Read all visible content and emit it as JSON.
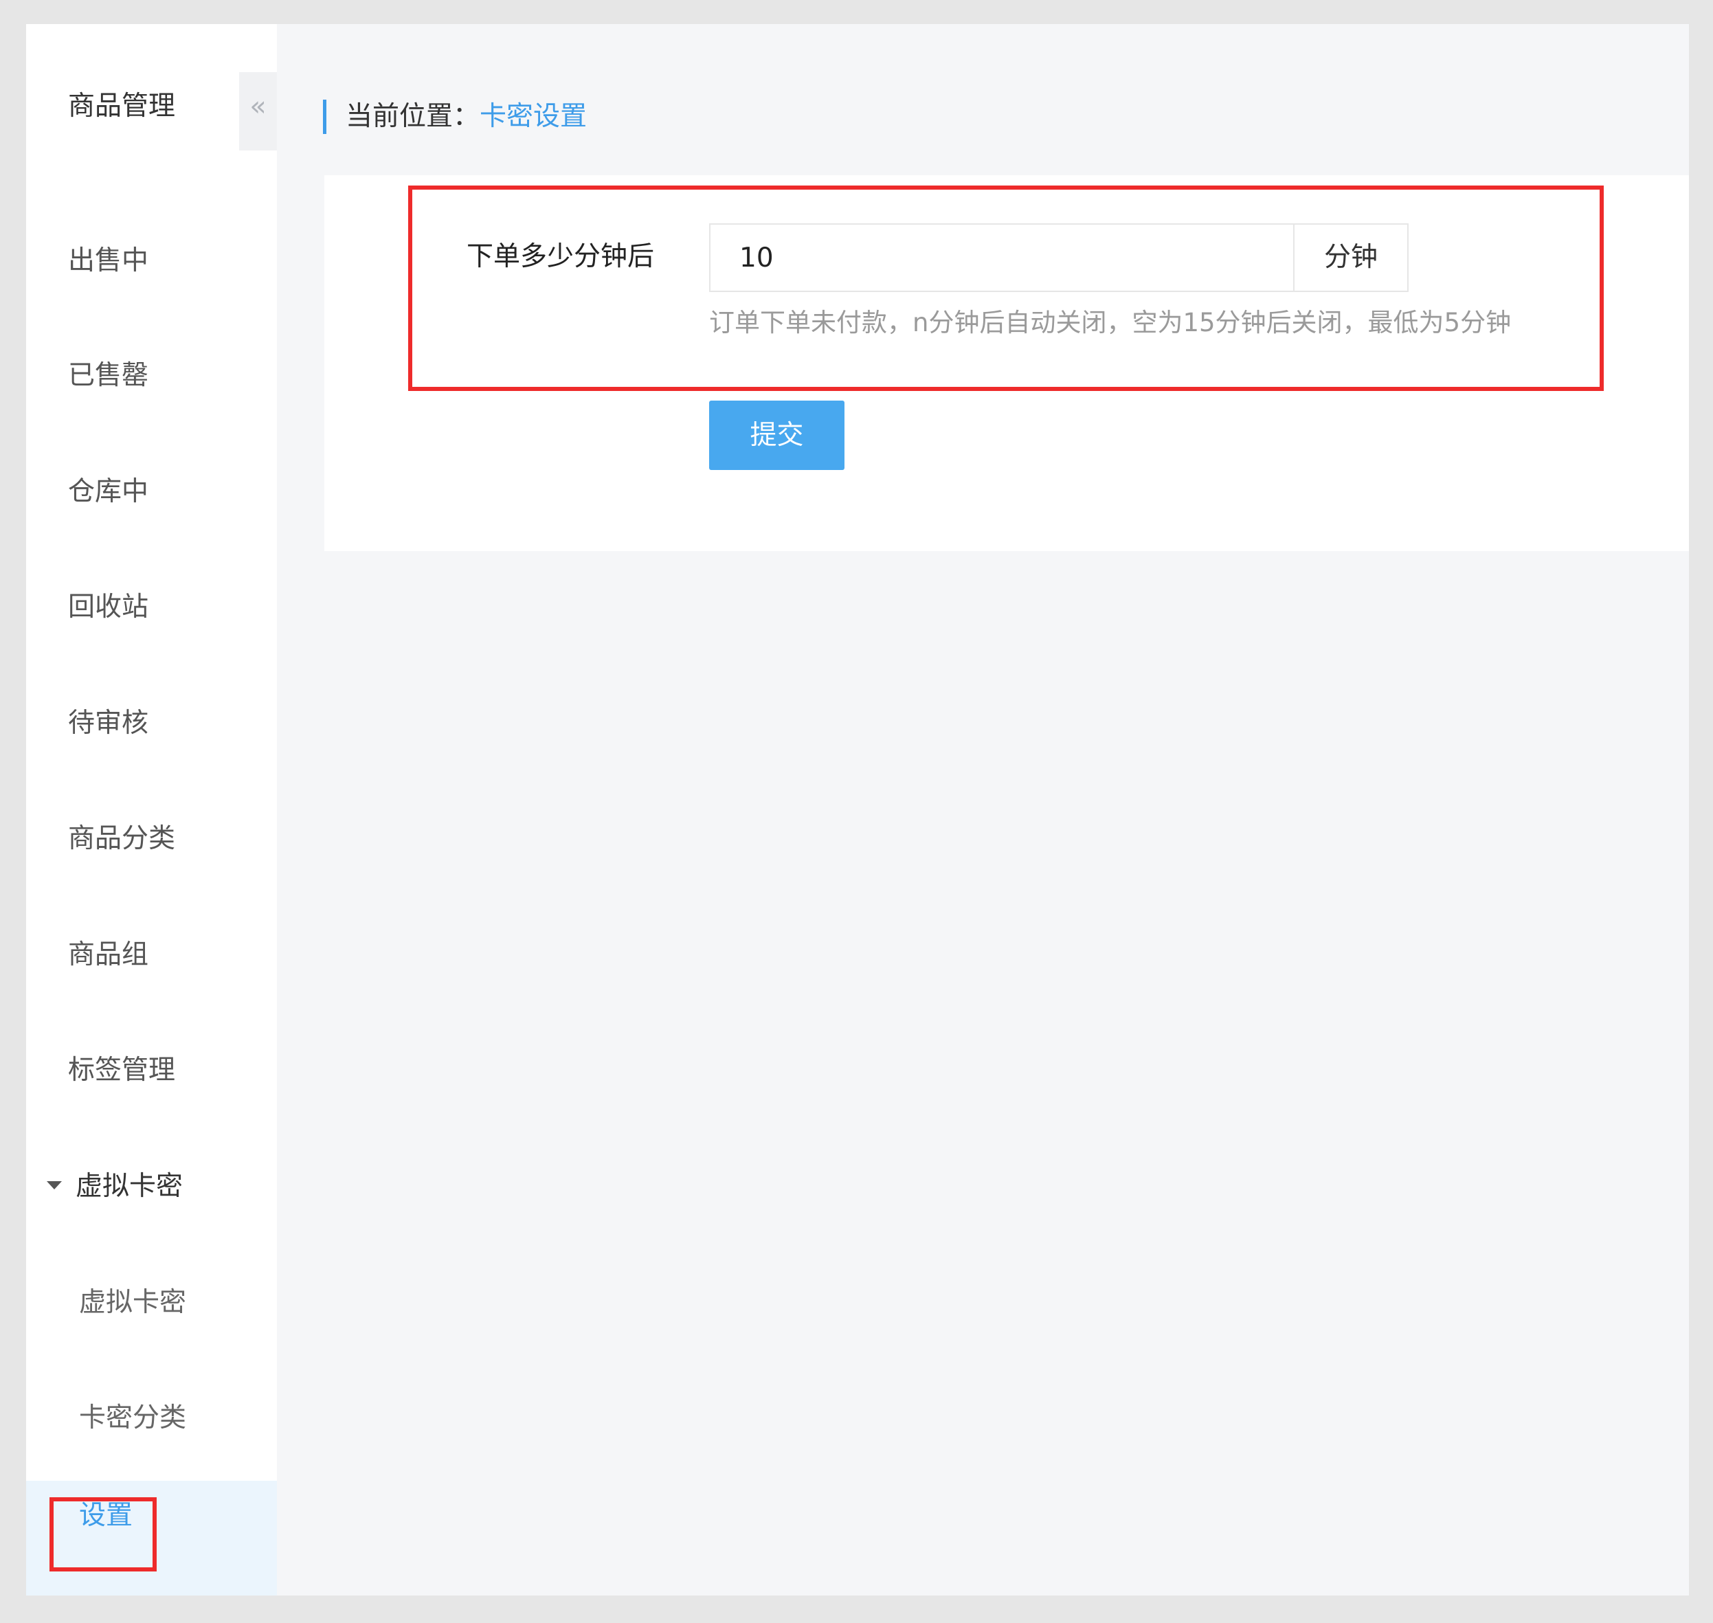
{
  "sidebar": {
    "title": "商品管理",
    "collapse_glyph": "«",
    "items": [
      {
        "label": "出售中"
      },
      {
        "label": "已售罄"
      },
      {
        "label": "仓库中"
      },
      {
        "label": "回收站"
      },
      {
        "label": "待审核"
      },
      {
        "label": "商品分类"
      },
      {
        "label": "商品组"
      },
      {
        "label": "标签管理"
      }
    ],
    "group": {
      "label": "虚拟卡密",
      "expanded": true,
      "children": [
        {
          "label": "虚拟卡密"
        },
        {
          "label": "卡密分类"
        },
        {
          "label": "设置",
          "active": true
        }
      ]
    }
  },
  "breadcrumb": {
    "prefix": "当前位置：",
    "current": "卡密设置"
  },
  "form": {
    "field_label": "下单多少分钟后",
    "minutes_value": "10",
    "unit": "分钟",
    "help": "订单下单未付款，n分钟后自动关闭，空为15分钟后关闭，最低为5分钟",
    "submit_label": "提交"
  },
  "colors": {
    "accent": "#3e9ce9",
    "button": "#48a8ef",
    "highlight": "#ee2b2b",
    "active_bg": "#ebf5fd"
  }
}
